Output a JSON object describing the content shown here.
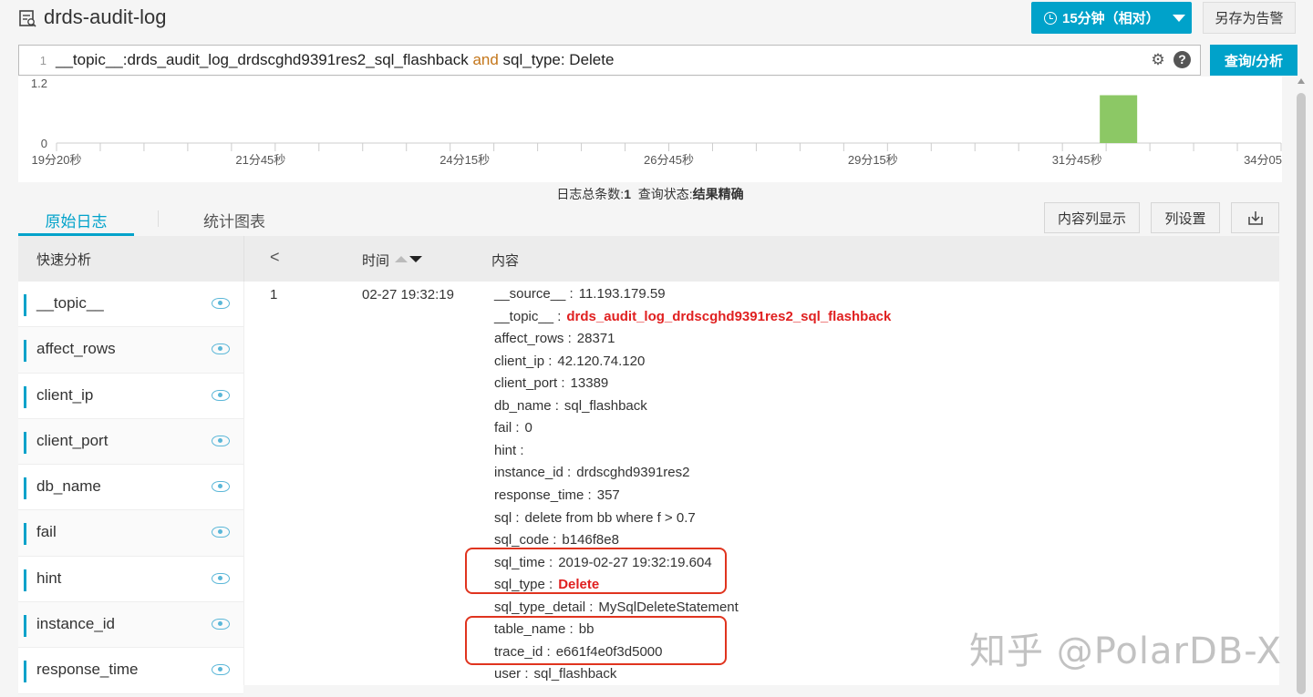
{
  "header": {
    "title": "drds-audit-log",
    "time_range_label": "15分钟（相对）",
    "save_alert_label": "另存为告警"
  },
  "query": {
    "line_number": "1",
    "part1": "__topic__:drds_audit_log_drdscghd9391res2_sql_flashback",
    "keyword": " and ",
    "part2": "sql_type: Delete",
    "search_label": "查询/分析"
  },
  "histogram": {
    "y_max_label": "1.2",
    "y_min_label": "0",
    "ticks": [
      "19分20秒",
      "21分45秒",
      "24分15秒",
      "26分45秒",
      "29分15秒",
      "31分45秒",
      "34分05"
    ],
    "bar_color": "#8cc865"
  },
  "chart_data": {
    "type": "bar",
    "categories": [
      "19分20秒",
      "21分45秒",
      "24分15秒",
      "26分45秒",
      "29分15秒",
      "31分45秒",
      "34分05"
    ],
    "values": [
      0,
      0,
      0,
      0,
      0,
      1,
      0
    ],
    "ylim": [
      0,
      1.2
    ]
  },
  "summary": {
    "count_label": "日志总条数:",
    "count_value": "1",
    "status_label": "查询状态:",
    "status_value": "结果精确"
  },
  "tabs": {
    "raw": "原始日志",
    "stats": "统计图表"
  },
  "toolbar": {
    "columns_label": "内容列显示",
    "settings_label": "列设置"
  },
  "left_panel": {
    "title": "快速分析",
    "fields": [
      "__topic__",
      "affect_rows",
      "client_ip",
      "client_port",
      "db_name",
      "fail",
      "hint",
      "instance_id",
      "response_time"
    ]
  },
  "table": {
    "col_time": "时间",
    "col_content": "内容",
    "row": {
      "index": "1",
      "time": "02-27 19:32:19",
      "entries": [
        {
          "k": "__source__ :",
          "v": "11.193.179.59"
        },
        {
          "k": "__topic__ :",
          "v": "drds_audit_log_drdscghd9391res2_sql_flashback"
        },
        {
          "k": "affect_rows :",
          "v": "28371"
        },
        {
          "k": "client_ip :",
          "v": "42.120.74.120"
        },
        {
          "k": "client_port :",
          "v": "13389"
        },
        {
          "k": "db_name :",
          "v": "sql_flashback"
        },
        {
          "k": "fail :",
          "v": "0"
        },
        {
          "k": "hint :",
          "v": ""
        },
        {
          "k": "instance_id :",
          "v": "drdscghd9391res2"
        },
        {
          "k": "response_time :",
          "v": "357"
        },
        {
          "k": "sql :",
          "v": "delete from bb where f > 0.7"
        },
        {
          "k": "sql_code :",
          "v": "b146f8e8"
        },
        {
          "k": "sql_time :",
          "v": "2019-02-27 19:32:19.604"
        },
        {
          "k": "sql_type :",
          "v": "Delete"
        },
        {
          "k": "sql_type_detail :",
          "v": "MySqlDeleteStatement"
        },
        {
          "k": "table_name :",
          "v": "bb"
        },
        {
          "k": "trace_id :",
          "v": "e661f4e0f3d5000"
        },
        {
          "k": "user :",
          "v": "sql_flashback"
        }
      ]
    }
  },
  "watermark": "知乎 @PolarDB-X"
}
